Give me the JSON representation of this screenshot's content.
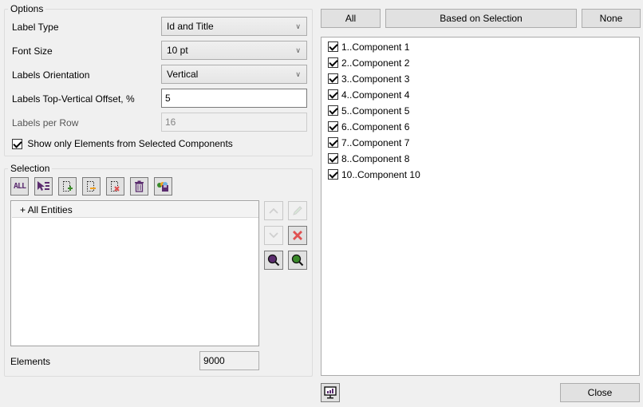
{
  "options": {
    "title": "Options",
    "label_type": {
      "label": "Label Type",
      "value": "Id and Title"
    },
    "font_size": {
      "label": "Font Size",
      "value": "10 pt"
    },
    "labels_orientation": {
      "label": "Labels Orientation",
      "value": "Vertical"
    },
    "labels_offset": {
      "label": "Labels Top-Vertical Offset, %",
      "value": "5"
    },
    "labels_per_row": {
      "label": "Labels per Row",
      "value": "16"
    },
    "show_only_selected": {
      "label": "Show only Elements from Selected Components",
      "checked": true
    }
  },
  "selection": {
    "title": "Selection",
    "toolbar": [
      {
        "name": "select-all-icon",
        "tooltip": "ALL"
      },
      {
        "name": "select-list-icon"
      },
      {
        "name": "add-selection-icon"
      },
      {
        "name": "subtract-selection-icon"
      },
      {
        "name": "remove-selection-icon"
      },
      {
        "name": "trash-icon"
      },
      {
        "name": "save-selection-icon"
      }
    ],
    "tree_root": "+ All Entities",
    "elements_label": "Elements",
    "elements_value": "9000"
  },
  "component_buttons": {
    "all": "All",
    "based_on_selection": "Based on Selection",
    "none": "None"
  },
  "components": [
    {
      "label": "1..Component 1",
      "checked": true
    },
    {
      "label": "2..Component 2",
      "checked": true
    },
    {
      "label": "3..Component 3",
      "checked": true
    },
    {
      "label": "4..Component 4",
      "checked": true
    },
    {
      "label": "5..Component 5",
      "checked": true
    },
    {
      "label": "6..Component 6",
      "checked": true
    },
    {
      "label": "7..Component 7",
      "checked": true
    },
    {
      "label": "8..Component 8",
      "checked": true
    },
    {
      "label": "10..Component 10",
      "checked": true
    }
  ],
  "footer": {
    "close": "Close"
  },
  "colors": {
    "accent_purple": "#5b2c6f",
    "green": "#3a8a2a",
    "red": "#e05050",
    "orange": "#f0a020"
  }
}
